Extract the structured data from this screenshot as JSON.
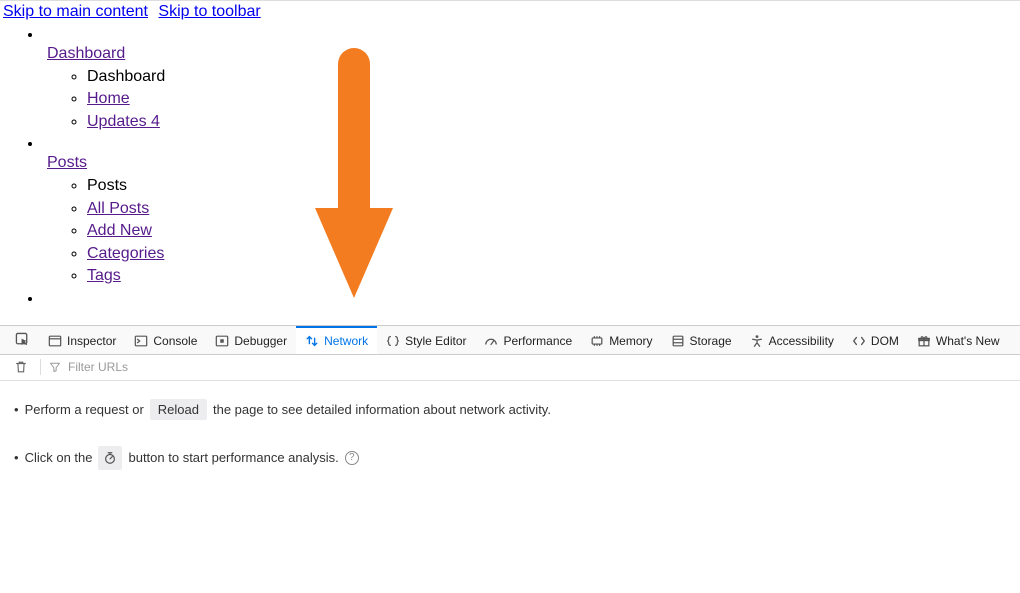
{
  "skip": {
    "main": "Skip to main content",
    "toolbar": "Skip to toolbar"
  },
  "nav": {
    "dashboard": {
      "title": "Dashboard",
      "items": {
        "dash": "Dashboard",
        "home": "Home",
        "updates": "Updates 4"
      }
    },
    "posts": {
      "title": "Posts",
      "items": {
        "posts": "Posts",
        "all": "All Posts",
        "add": "Add New",
        "cat": "Categories",
        "tags": "Tags"
      }
    }
  },
  "devtools": {
    "tabs": {
      "inspector": "Inspector",
      "console": "Console",
      "debugger": "Debugger",
      "network": "Network",
      "style": "Style Editor",
      "perf": "Performance",
      "memory": "Memory",
      "storage": "Storage",
      "a11y": "Accessibility",
      "dom": "DOM",
      "whatsnew": "What's New"
    },
    "filter_placeholder": "Filter URLs",
    "empty": {
      "l1a": "Perform a request or",
      "reload": "Reload",
      "l1b": "the page to see detailed information about network activity.",
      "l2a": "Click on the",
      "l2b": "button to start performance analysis."
    }
  }
}
